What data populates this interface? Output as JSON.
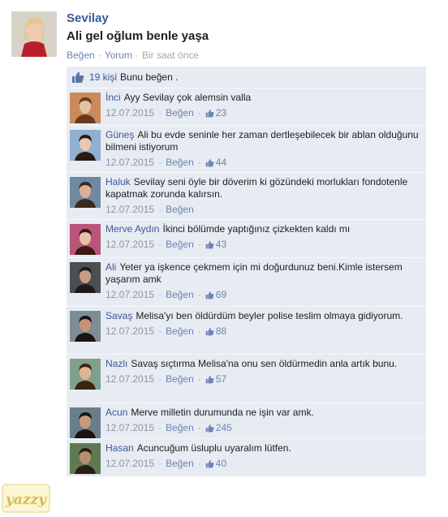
{
  "post": {
    "author": "Sevilay",
    "text": "Ali gel oğlum benle yaşa",
    "actions": {
      "like": "Beğen",
      "comment": "Yorum",
      "time": "Bir saat önce"
    },
    "likes_count": "19 kişi",
    "likes_suffix": "Bunu beğen ."
  },
  "icons": {
    "like": "thumbs-up-icon",
    "small_like": "small-thumbs-up-icon"
  },
  "colors": {
    "link": "#3b5998",
    "box_bg": "#e7ebf2",
    "meta": "#8b95a6"
  },
  "comments": [
    {
      "name": "İnci",
      "text": "Ayy Sevilay çok alemsin valla",
      "date": "12.07.2015",
      "like_label": "Beğen",
      "likes": "23"
    },
    {
      "name": "Güneş",
      "text": "Ali bu evde seninle her zaman dertleşebilecek bir ablan olduğunu bilmeni istiyorum",
      "date": "12.07.2015",
      "like_label": "Beğen",
      "likes": "44"
    },
    {
      "name": "Haluk",
      "text": "Sevilay seni öyle bir döverim ki gözündeki morlukları fondotenle kapatmak zorunda kalırsın.",
      "date": "12.07.2015",
      "like_label": "Beğen",
      "likes": ""
    },
    {
      "name": "Merve Aydın",
      "text": "İkinci bölümde yaptığınız çizkekten kaldı mı",
      "date": "12.07.2015",
      "like_label": "Beğen",
      "likes": "43"
    },
    {
      "name": "Ali",
      "text": "Yeter ya işkence çekmem için mi doğurdunuz beni.Kimle istersem yaşarım amk",
      "date": "12.07.2015",
      "like_label": "Beğen",
      "likes": "69"
    },
    {
      "name": "Savaş",
      "text": "Melisa'yı ben öldürdüm beyler polise teslim olmaya gidiyorum.",
      "date": "12.07.2015",
      "like_label": "Beğen",
      "likes": "88"
    },
    {
      "name": "Nazlı",
      "text": "Savaş sıçtırma Melisa'na onu sen öldürmedin anla artık bunu.",
      "date": "12.07.2015",
      "like_label": "Beğen",
      "likes": "57"
    },
    {
      "name": "Acun",
      "text": "Merve milletin durumunda ne işin var amk.",
      "date": "12.07.2015",
      "like_label": "Beğen",
      "likes": "245"
    },
    {
      "name": "Hasan",
      "text": "Acuncuğum üsluplu uyaralım lütfen.",
      "date": "12.07.2015",
      "like_label": "Beğen",
      "likes": "40"
    }
  ],
  "watermark": "yazzy"
}
